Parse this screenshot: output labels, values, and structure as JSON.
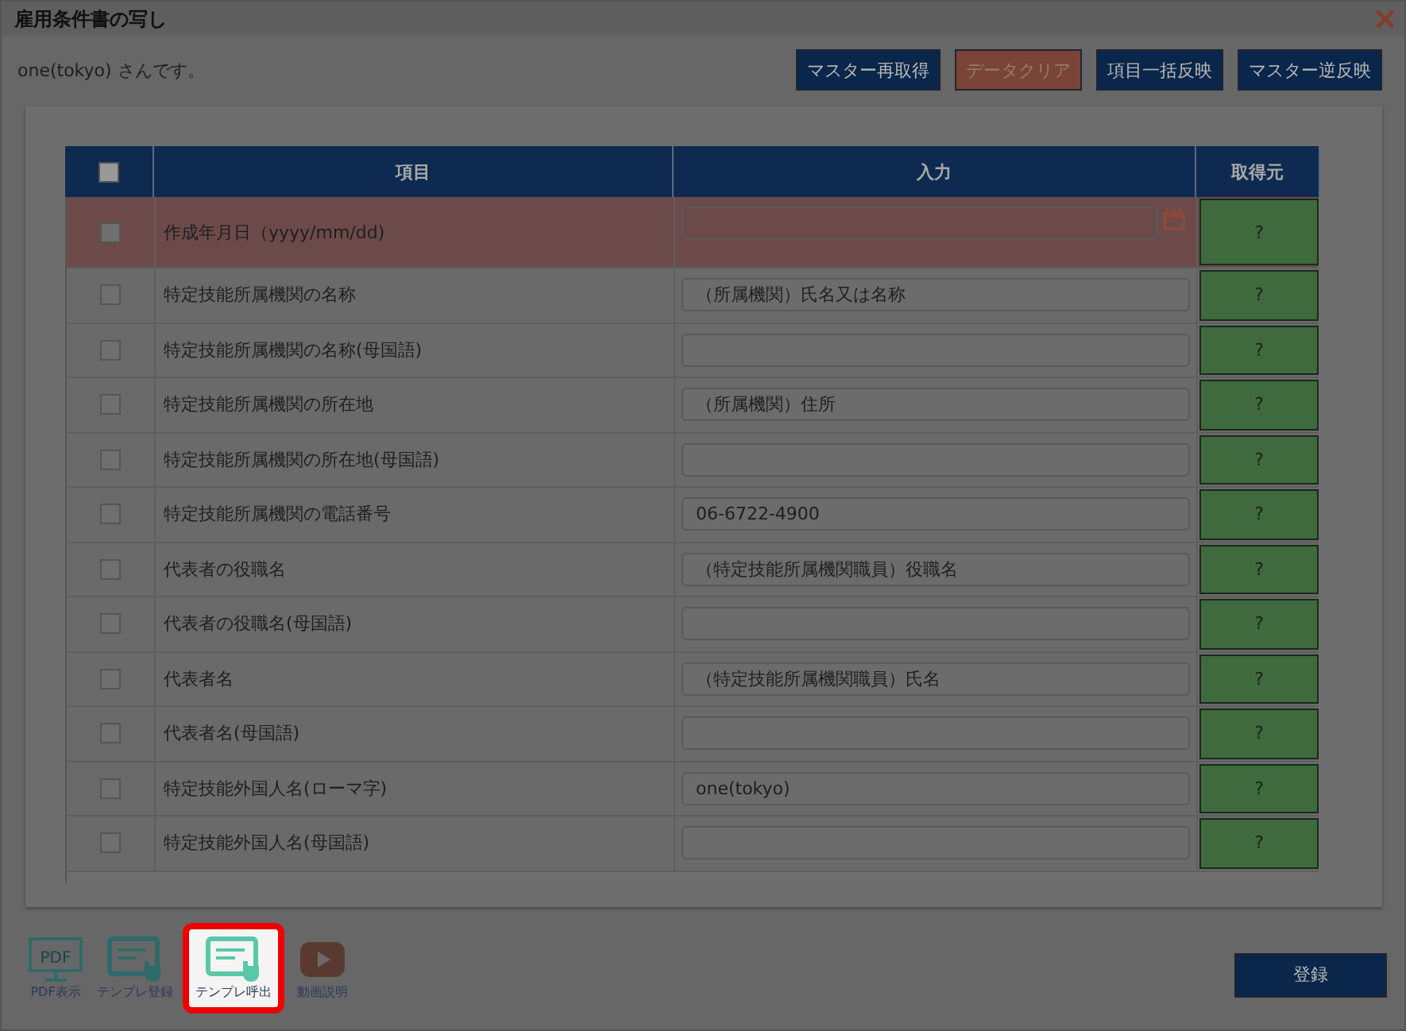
{
  "window": {
    "title": "雇用条件書の写し"
  },
  "user_text": "one(tokyo) さんです。",
  "header_buttons": [
    {
      "label": "マスター再取得",
      "kind": "primary"
    },
    {
      "label": "データクリア",
      "kind": "danger"
    },
    {
      "label": "項目一括反映",
      "kind": "primary"
    },
    {
      "label": "マスター逆反映",
      "kind": "primary"
    }
  ],
  "table": {
    "select_all": {
      "checked": false
    },
    "columns": [
      "項目",
      "入力",
      "取得元"
    ],
    "rows": [
      {
        "checked": false,
        "error": true,
        "kind": "date",
        "item": "作成年月日（yyyy/mm/dd)",
        "value": "",
        "source": "?"
      },
      {
        "checked": false,
        "error": false,
        "kind": "text",
        "item": "特定技能所属機関の名称",
        "value": "（所属機関）氏名又は名称",
        "source": "?"
      },
      {
        "checked": false,
        "error": false,
        "kind": "text",
        "item": "特定技能所属機関の名称(母国語)",
        "value": "",
        "source": "?"
      },
      {
        "checked": false,
        "error": false,
        "kind": "text",
        "item": "特定技能所属機関の所在地",
        "value": "（所属機関）住所",
        "source": "?"
      },
      {
        "checked": false,
        "error": false,
        "kind": "text",
        "item": "特定技能所属機関の所在地(母国語)",
        "value": "",
        "source": "?"
      },
      {
        "checked": false,
        "error": false,
        "kind": "text",
        "item": "特定技能所属機関の電話番号",
        "value": "06-6722-4900",
        "source": "?"
      },
      {
        "checked": false,
        "error": false,
        "kind": "text",
        "item": "代表者の役職名",
        "value": "（特定技能所属機関職員）役職名",
        "source": "?"
      },
      {
        "checked": false,
        "error": false,
        "kind": "text",
        "item": "代表者の役職名(母国語)",
        "value": "",
        "source": "?"
      },
      {
        "checked": false,
        "error": false,
        "kind": "text",
        "item": "代表者名",
        "value": "（特定技能所属機関職員）氏名",
        "source": "?"
      },
      {
        "checked": false,
        "error": false,
        "kind": "text",
        "item": "代表者名(母国語)",
        "value": "",
        "source": "?"
      },
      {
        "checked": false,
        "error": false,
        "kind": "text",
        "item": "特定技能外国人名(ローマ字)",
        "value": "one(tokyo)",
        "source": "?"
      },
      {
        "checked": false,
        "error": false,
        "kind": "text",
        "item": "特定技能外国人名(母国語)",
        "value": "",
        "source": "?"
      }
    ]
  },
  "tools": [
    {
      "label": "PDF表示",
      "kind": "pdf",
      "icon_text": "PDF",
      "selected": false
    },
    {
      "label": "テンプレ登録",
      "kind": "template-save",
      "selected": false
    },
    {
      "label": "テンプレ呼出",
      "kind": "template-load",
      "selected": true
    },
    {
      "label": "動画説明",
      "kind": "video",
      "selected": false
    }
  ],
  "submit_button": "登録"
}
